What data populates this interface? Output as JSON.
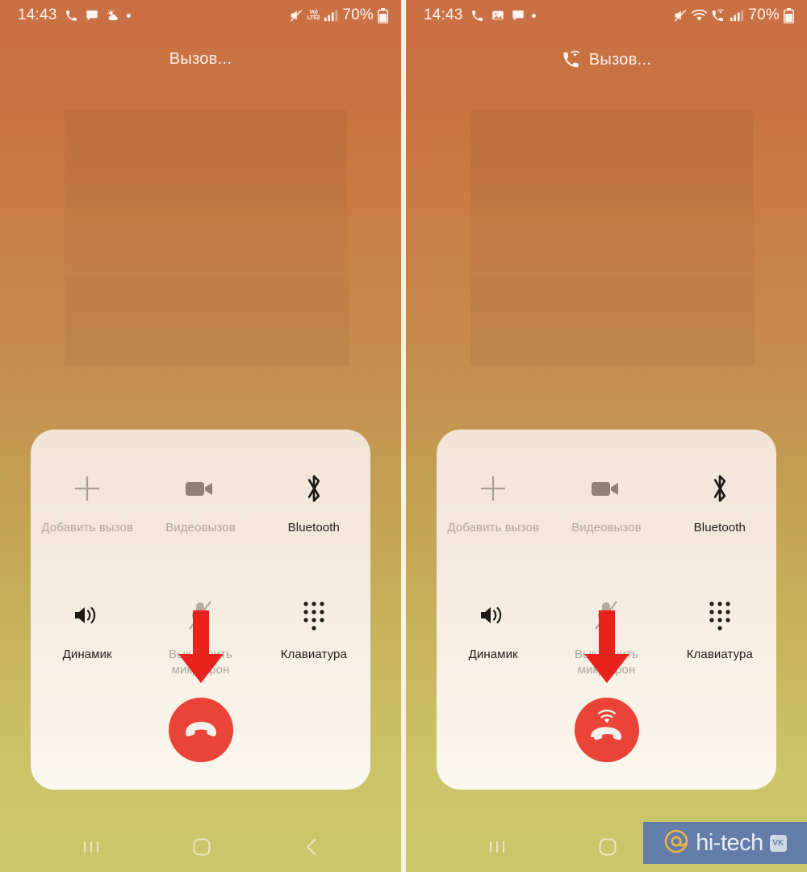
{
  "panels": [
    {
      "id": "left",
      "status": {
        "time": "14:43",
        "left_icons": [
          "phone-icon",
          "message-icon",
          "weather-icon",
          "dot-icon"
        ],
        "right_icons": [
          "mute-icon",
          "volte-icon",
          "signal-icon"
        ],
        "volte_top": "Vo)",
        "volte_bottom": "LTE2",
        "battery": "70%"
      },
      "call": {
        "title": "Вызов...",
        "has_wifi_call_icon": false
      },
      "end_call": {
        "icon": "hangup-icon",
        "wifi": false,
        "color": "#ea4337"
      }
    },
    {
      "id": "right",
      "status": {
        "time": "14:43",
        "left_icons": [
          "phone-icon",
          "image-icon",
          "message-icon",
          "dot-icon"
        ],
        "right_icons": [
          "mute-icon",
          "wifi-icon",
          "wifi-call-icon",
          "signal-icon"
        ],
        "volte_top": "",
        "volte_bottom": "",
        "battery": "70%"
      },
      "call": {
        "title": "Вызов...",
        "has_wifi_call_icon": true
      },
      "end_call": {
        "icon": "hangup-wifi-icon",
        "wifi": true,
        "color": "#ea4337"
      }
    }
  ],
  "controls": {
    "row1": [
      {
        "label": "Добавить вызов",
        "icon": "add-call-icon",
        "enabled": false
      },
      {
        "label": "Видеовызов",
        "icon": "video-call-icon",
        "enabled": false
      },
      {
        "label": "Bluetooth",
        "icon": "bluetooth-icon",
        "enabled": true
      }
    ],
    "row2": [
      {
        "label": "Динамик",
        "icon": "speaker-icon",
        "enabled": true
      },
      {
        "label": "Выключить микрофон",
        "icon": "mute-mic-icon",
        "enabled": false
      },
      {
        "label": "Клавиатура",
        "icon": "keypad-icon",
        "enabled": true
      }
    ]
  },
  "navbar": {
    "recents": "recents-icon",
    "home": "home-icon",
    "back": "back-icon"
  },
  "watermark": {
    "text": "hi-tech",
    "badge": "VK",
    "at": "@",
    "background": "#637da8"
  },
  "theme": {
    "gradient_top": "#c96f45",
    "gradient_bottom": "#cbc76c",
    "card": "#f3e7dc",
    "accent_red": "#ea4337",
    "arrow_red": "#e8231f",
    "text_dark": "#201c19",
    "text_dim": "#b0a69d"
  }
}
